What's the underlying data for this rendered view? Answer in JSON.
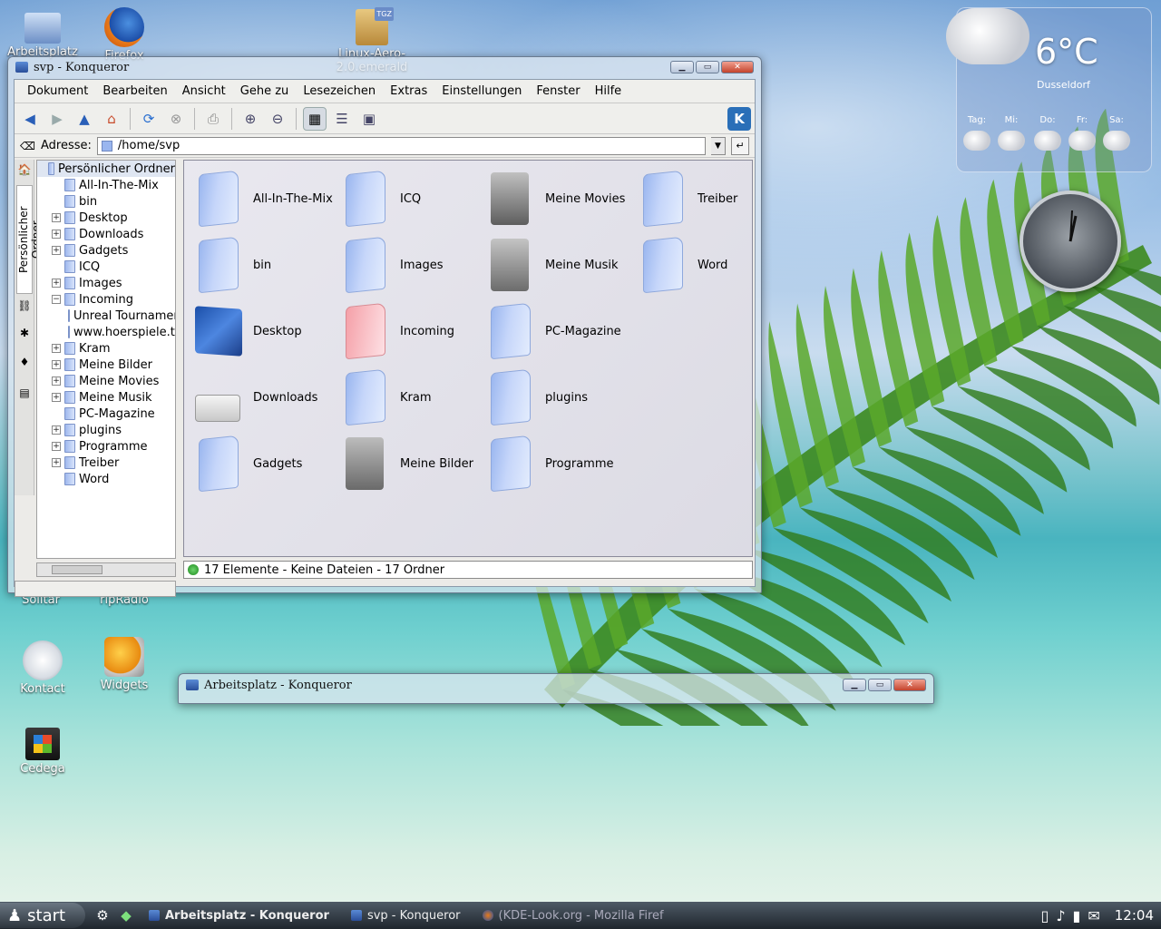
{
  "desktop": {
    "icons": [
      {
        "label": "Arbeitsplatz"
      },
      {
        "label": "Firefox"
      },
      {
        "label": "Linux-Aero-2.0.emerald"
      },
      {
        "label": "Solitär"
      },
      {
        "label": "ripRadio"
      },
      {
        "label": "Kontact"
      },
      {
        "label": "Widgets"
      },
      {
        "label": "Cedega"
      }
    ],
    "tgz_badge": "TGZ"
  },
  "weather": {
    "temp": "6°C",
    "city": "Dusseldorf",
    "days": [
      "Tag:",
      "Mi:",
      "Do:",
      "Fr:",
      "Sa:"
    ]
  },
  "konqueror": {
    "title": "svp - Konqueror",
    "menu": [
      "Dokument",
      "Bearbeiten",
      "Ansicht",
      "Gehe zu",
      "Lesezeichen",
      "Extras",
      "Einstellungen",
      "Fenster",
      "Hilfe"
    ],
    "address_label": "Adresse:",
    "address_value": "/home/svp",
    "side_tab_label": "Persönlicher Ordner",
    "tree": [
      {
        "label": "Persönlicher Ordner",
        "exp": "",
        "level": 0
      },
      {
        "label": "All-In-The-Mix",
        "exp": "",
        "level": 1
      },
      {
        "label": "bin",
        "exp": "",
        "level": 1
      },
      {
        "label": "Desktop",
        "exp": "+",
        "level": 1
      },
      {
        "label": "Downloads",
        "exp": "+",
        "level": 1
      },
      {
        "label": "Gadgets",
        "exp": "+",
        "level": 1
      },
      {
        "label": "ICQ",
        "exp": "",
        "level": 1
      },
      {
        "label": "Images",
        "exp": "+",
        "level": 1
      },
      {
        "label": "Incoming",
        "exp": "−",
        "level": 1
      },
      {
        "label": "Unreal Tournamer",
        "exp": "",
        "level": 2
      },
      {
        "label": "www.hoerspiele.tc",
        "exp": "",
        "level": 2
      },
      {
        "label": "Kram",
        "exp": "+",
        "level": 1
      },
      {
        "label": "Meine Bilder",
        "exp": "+",
        "level": 1
      },
      {
        "label": "Meine Movies",
        "exp": "+",
        "level": 1
      },
      {
        "label": "Meine Musik",
        "exp": "+",
        "level": 1
      },
      {
        "label": "PC-Magazine",
        "exp": "",
        "level": 1
      },
      {
        "label": "plugins",
        "exp": "+",
        "level": 1
      },
      {
        "label": "Programme",
        "exp": "+",
        "level": 1
      },
      {
        "label": "Treiber",
        "exp": "+",
        "level": 1
      },
      {
        "label": "Word",
        "exp": "",
        "level": 1
      }
    ],
    "files": [
      {
        "label": "All-In-The-Mix",
        "kind": "folder"
      },
      {
        "label": "bin",
        "kind": "folder"
      },
      {
        "label": "Desktop",
        "kind": "desktop"
      },
      {
        "label": "Downloads",
        "kind": "downloads"
      },
      {
        "label": "Gadgets",
        "kind": "folder"
      },
      {
        "label": "ICQ",
        "kind": "folder"
      },
      {
        "label": "Images",
        "kind": "folder"
      },
      {
        "label": "Incoming",
        "kind": "incoming"
      },
      {
        "label": "Kram",
        "kind": "folder"
      },
      {
        "label": "Meine Bilder",
        "kind": "pictures"
      },
      {
        "label": "Meine Movies",
        "kind": "movies"
      },
      {
        "label": "Meine Musik",
        "kind": "music"
      },
      {
        "label": "PC-Magazine",
        "kind": "folder"
      },
      {
        "label": "plugins",
        "kind": "folder"
      },
      {
        "label": "Programme",
        "kind": "folder"
      },
      {
        "label": "Treiber",
        "kind": "folder"
      },
      {
        "label": "Word",
        "kind": "folder"
      }
    ],
    "status": "17 Elemente - Keine Dateien - 17 Ordner"
  },
  "konqueror2": {
    "title": "Arbeitsplatz - Konqueror"
  },
  "taskbar": {
    "start": "start",
    "tasks": [
      {
        "label": "Arbeitsplatz - Konqueror",
        "active": true
      },
      {
        "label": "svp - Konqueror",
        "active": false
      },
      {
        "label": "(KDE-Look.org - Mozilla Firef",
        "active": false
      }
    ],
    "time": "12:04"
  },
  "colors": {
    "accent": "#3a6fc6",
    "folder": "#9ab6ef",
    "close": "#c4432c"
  }
}
